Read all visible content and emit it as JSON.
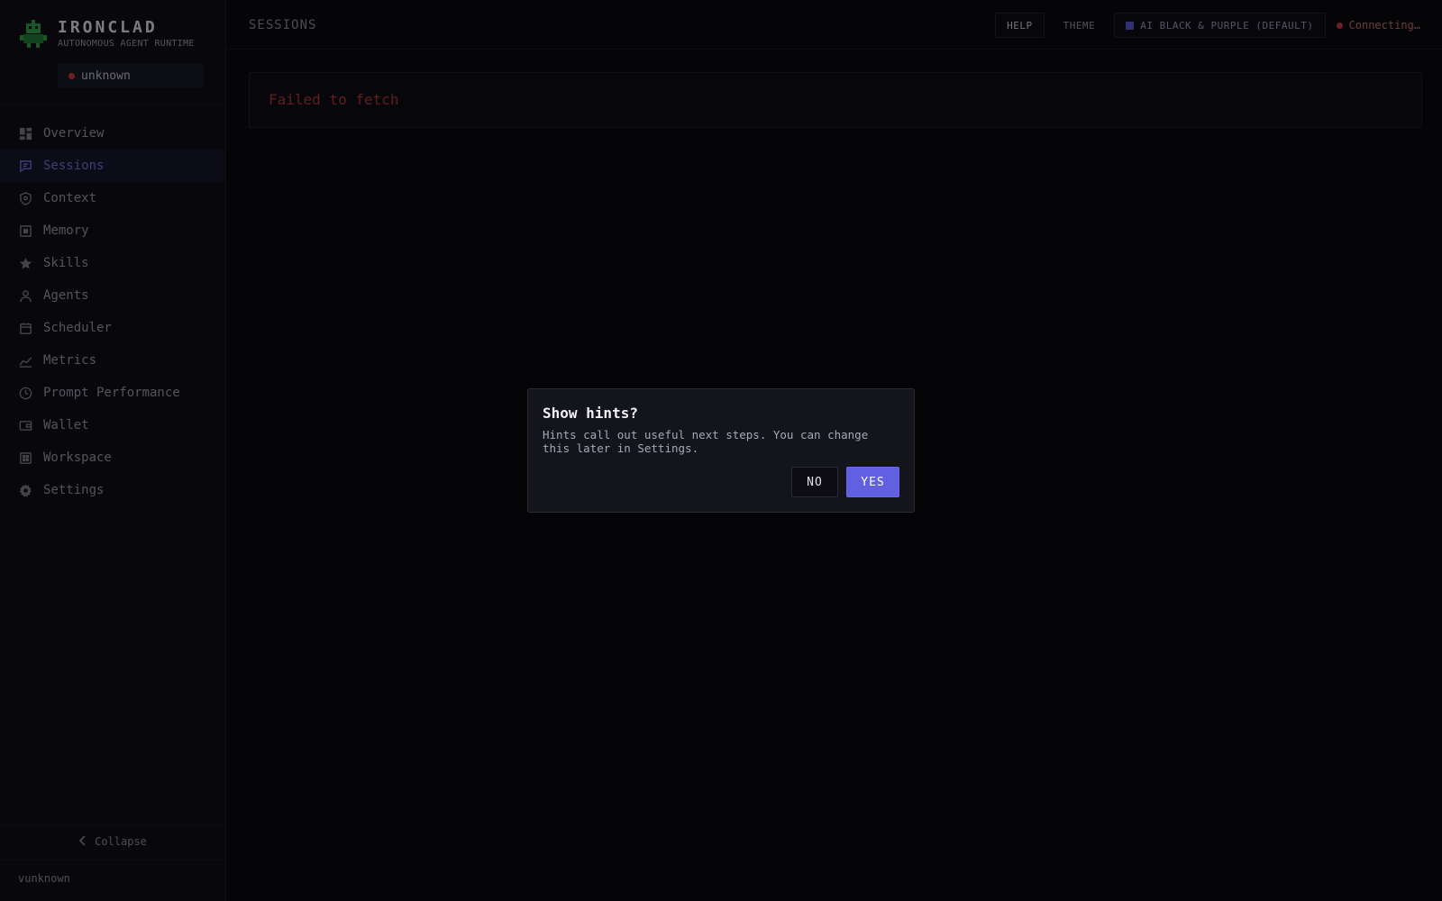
{
  "brand": {
    "name": "IRONCLAD",
    "subtitle": "AUTONOMOUS AGENT RUNTIME"
  },
  "status": {
    "label": "unknown",
    "color": "#d03838"
  },
  "sidebar": {
    "items": [
      {
        "label": "Overview",
        "icon": "dashboard-icon"
      },
      {
        "label": "Sessions",
        "icon": "chat-icon",
        "active": true
      },
      {
        "label": "Context",
        "icon": "shield-icon"
      },
      {
        "label": "Memory",
        "icon": "memory-icon"
      },
      {
        "label": "Skills",
        "icon": "star-icon"
      },
      {
        "label": "Agents",
        "icon": "user-icon"
      },
      {
        "label": "Scheduler",
        "icon": "calendar-icon"
      },
      {
        "label": "Metrics",
        "icon": "chart-line-icon"
      },
      {
        "label": "Prompt Performance",
        "icon": "clock-icon"
      },
      {
        "label": "Wallet",
        "icon": "wallet-icon"
      },
      {
        "label": "Workspace",
        "icon": "grid-icon"
      },
      {
        "label": "Settings",
        "icon": "gear-icon"
      }
    ],
    "collapse_label": "Collapse",
    "version": "vunknown"
  },
  "header": {
    "title": "SESSIONS",
    "help_label": "HELP",
    "theme_label": "THEME",
    "theme_value": "AI BLACK & PURPLE (DEFAULT)",
    "connection": "Connecting…"
  },
  "main": {
    "error": "Failed to fetch"
  },
  "modal": {
    "title": "Show hints?",
    "body": "Hints call out useful next steps. You can change this later in Settings.",
    "no_label": "NO",
    "yes_label": "YES"
  },
  "colors": {
    "accent": "#6060e0",
    "error": "#b03838",
    "background": "#0a0a0f"
  }
}
